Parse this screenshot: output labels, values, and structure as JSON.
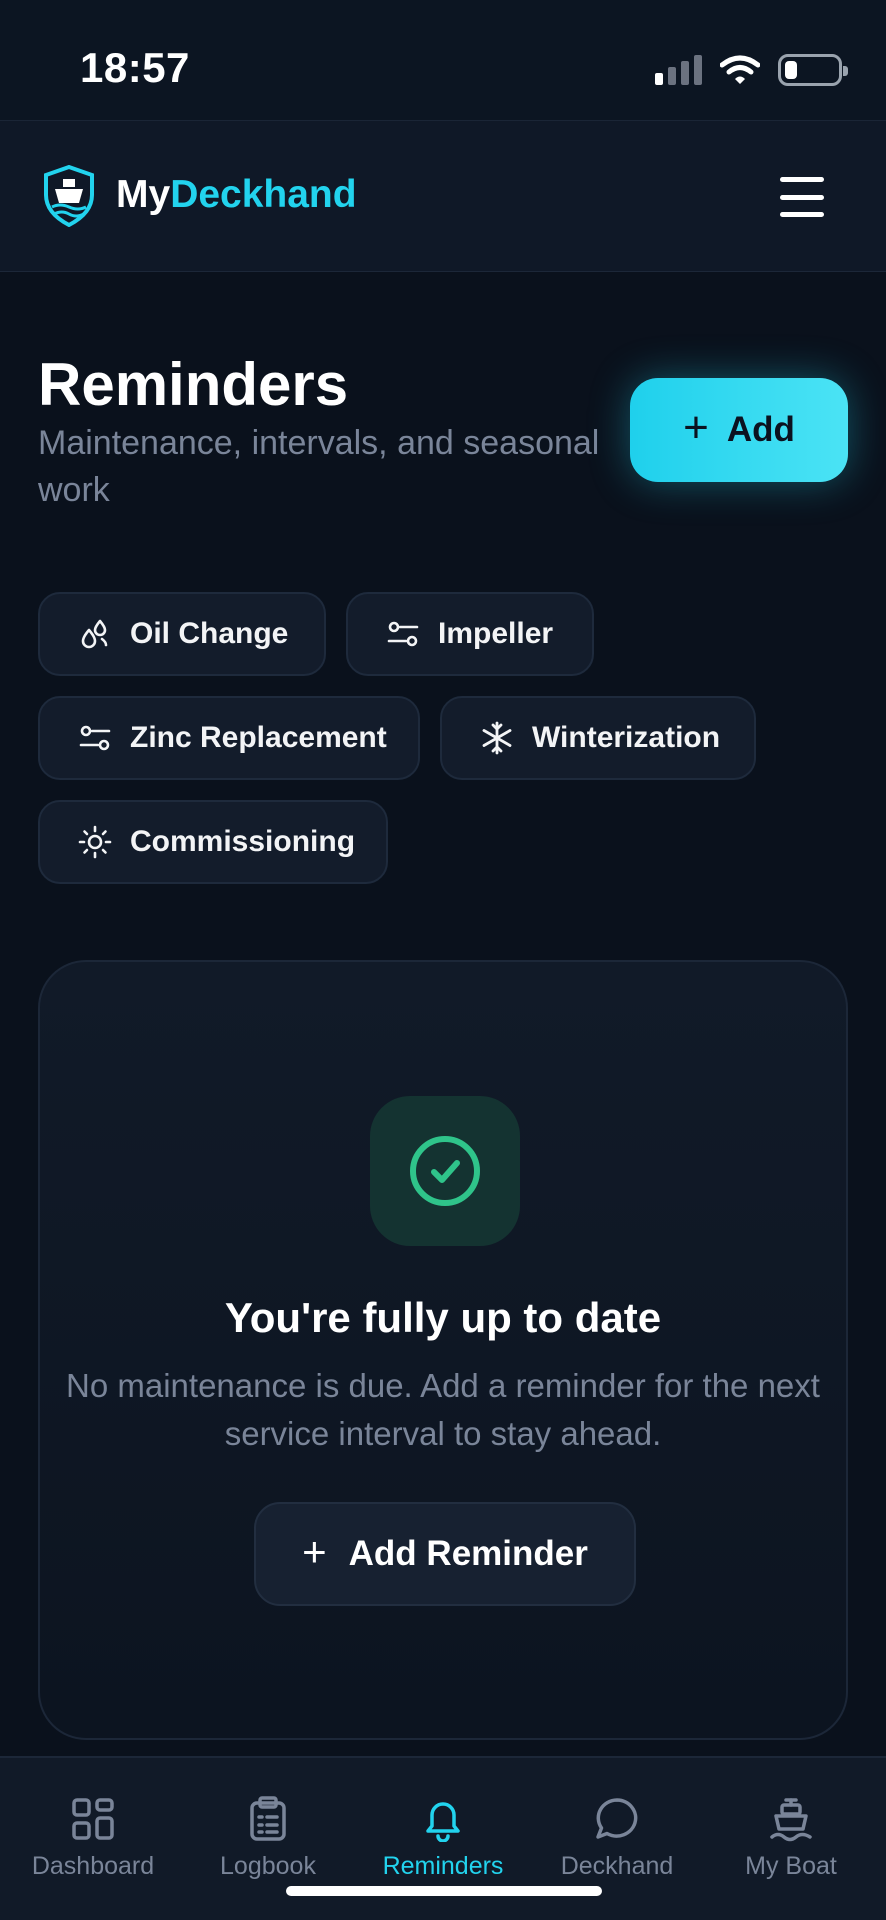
{
  "status_bar": {
    "time": "18:57"
  },
  "header": {
    "brand_prefix": "My",
    "brand_accent": "Deckhand",
    "accent_color": "#22d3ee"
  },
  "page": {
    "title": "Reminders",
    "subtitle": "Maintenance, intervals, and seasonal work",
    "add_label": "Add"
  },
  "categories": [
    {
      "label": "Oil Change",
      "icon": "oil-drop-icon"
    },
    {
      "label": "Impeller",
      "icon": "sliders-icon"
    },
    {
      "label": "Zinc Replacement",
      "icon": "sliders-icon"
    },
    {
      "label": "Winterization",
      "icon": "snowflake-icon"
    },
    {
      "label": "Commissioning",
      "icon": "sun-icon"
    }
  ],
  "empty_state": {
    "icon": "check-circle-icon",
    "title": "You're fully up to date",
    "description": "No maintenance is due. Add a reminder for the next service interval to stay ahead.",
    "button_label": "Add Reminder"
  },
  "nav": [
    {
      "label": "Dashboard",
      "icon": "grid-icon",
      "active": false
    },
    {
      "label": "Logbook",
      "icon": "clipboard-icon",
      "active": false
    },
    {
      "label": "Reminders",
      "icon": "bell-icon",
      "active": true
    },
    {
      "label": "Deckhand",
      "icon": "chat-bubble-icon",
      "active": false
    },
    {
      "label": "My Boat",
      "icon": "boat-icon",
      "active": false
    }
  ],
  "colors": {
    "accent": "#22d3ee",
    "success": "#2fc48a",
    "background": "#0a111c"
  }
}
